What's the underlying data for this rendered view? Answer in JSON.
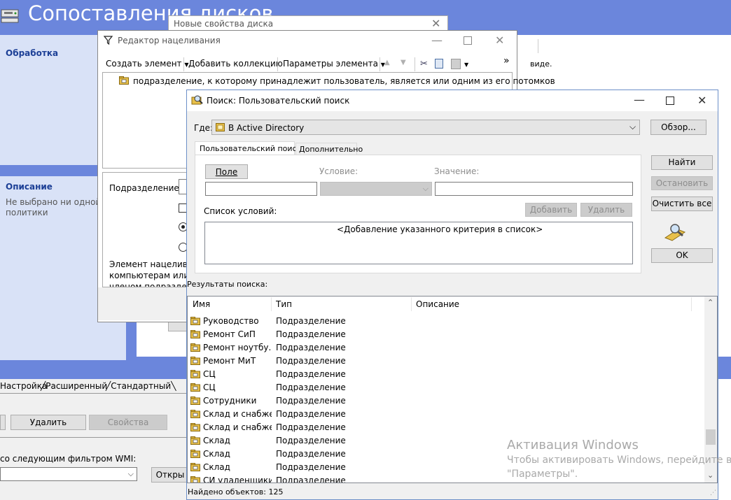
{
  "background": {
    "title": "Сопоставления дисков",
    "left_pane": {
      "processing_header": "Обработка",
      "description_header": "Описание",
      "description_text": "Не выбрано ни одной политики"
    },
    "right_text": "виде.",
    "tabs": [
      "Настройка",
      "Расширенный",
      "Стандартный"
    ],
    "buttons": {
      "delete": "Удалить",
      "properties": "Свойства",
      "open": "Откры"
    },
    "wmi_label": "со следующим фильтром WMI:"
  },
  "new_disk_window": {
    "title": "Новые свойства диска"
  },
  "targeting_editor": {
    "title": "Редактор нацеливания",
    "toolbar": {
      "new_item": "Создать элемент",
      "add_collection": "Добавить коллекцию",
      "item_options": "Параметры элемента",
      "more": "»"
    },
    "tree_item": "подразделение, к которому принадлежит пользователь, является  или одним из его потомков",
    "subdivision_label": "Подразделение",
    "description_lines": [
      "Элемент нацеливан",
      "компьютерам или п",
      "членом подразделе"
    ]
  },
  "search_window": {
    "title": "Поиск: Пользовательский поиск",
    "where_label": "Где:",
    "where_value": "В Active Directory",
    "browse_button": "Обзор...",
    "tabs": [
      "Пользовательский поиск",
      "Дополнительно"
    ],
    "field_button": "Поле",
    "condition_label": "Условие:",
    "value_label": "Значение:",
    "conditions_list_label": "Список условий:",
    "add_button": "Добавить",
    "remove_button": "Удалить",
    "conditions_placeholder": "<Добавление указанного критерия в список>",
    "find_button": "Найти",
    "stop_button": "Остановить",
    "clear_all_button": "Очистить все",
    "ok_button": "OK",
    "results_label": "Результаты поиска:",
    "columns": [
      "Имя",
      "Тип",
      "Описание"
    ],
    "rows": [
      {
        "name": "Руководство",
        "type": "Подразделение"
      },
      {
        "name": "Ремонт СиП",
        "type": "Подразделение"
      },
      {
        "name": "Ремонт ноутбу...",
        "type": "Подразделение"
      },
      {
        "name": "Ремонт МиТ",
        "type": "Подразделение"
      },
      {
        "name": "СЦ",
        "type": "Подразделение"
      },
      {
        "name": "СЦ",
        "type": "Подразделение"
      },
      {
        "name": "Сотрудники",
        "type": "Подразделение"
      },
      {
        "name": "Склад и снабже...",
        "type": "Подразделение"
      },
      {
        "name": "Склад и снабже...",
        "type": "Подразделение"
      },
      {
        "name": "Склад",
        "type": "Подразделение"
      },
      {
        "name": "Склад",
        "type": "Подразделение"
      },
      {
        "name": "Склад",
        "type": "Подразделение"
      },
      {
        "name": "СИ удаленщики",
        "type": "Подразделение"
      }
    ],
    "status": "Найдено объектов: 125"
  },
  "watermark": {
    "line1": "Активация Windows",
    "line2": "Чтобы активировать Windows, перейдите в раз",
    "line3": "\"Параметры\"."
  },
  "colors": {
    "accent": "#6b86dc",
    "window_bg": "#f0f0f0",
    "folder": "#e8c04a"
  }
}
